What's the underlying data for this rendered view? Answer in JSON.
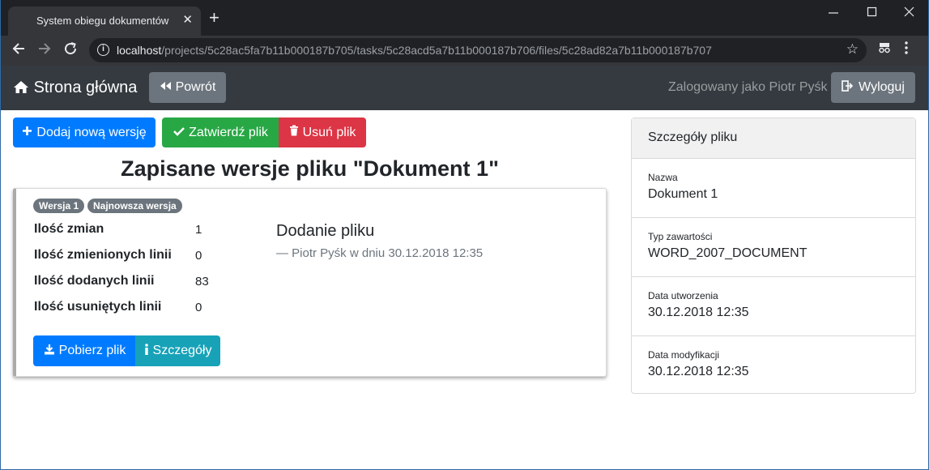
{
  "browser": {
    "tab_title": "System obiegu dokumentów",
    "tab_close": "✕",
    "new_tab": "+",
    "url_host": "localhost",
    "url_path": "/projects/5c28ac5fa7b11b000187b705/tasks/5c28acd5a7b11b000187b706/files/5c28ad82a7b11b000187b707",
    "icons": [
      "back-icon",
      "forward-icon",
      "reload-icon",
      "info-icon",
      "star-icon",
      "extension-icon",
      "menu-icon"
    ]
  },
  "navbar": {
    "brand": "Strona główna",
    "back_label": "Powrót",
    "logged_as": "Zalogowany jako Piotr Pyśk",
    "logout_label": "Wyloguj"
  },
  "toolbar": {
    "add_version": "Dodaj nową wersję",
    "approve": "Zatwierdź plik",
    "delete": "Usuń plik"
  },
  "page": {
    "title": "Zapisane wersje pliku \"Dokument 1\""
  },
  "version": {
    "badges": [
      "Wersja 1",
      "Najnowsza wersja"
    ],
    "stats": [
      {
        "label": "Ilość zmian",
        "value": "1"
      },
      {
        "label": "Ilość zmienionych linii",
        "value": "0"
      },
      {
        "label": "Ilość dodanych linii",
        "value": "83"
      },
      {
        "label": "Ilość usuniętych linii",
        "value": "0"
      }
    ],
    "commit_message": "Dodanie pliku",
    "commit_meta": "—  Piotr Pyśk w dniu 30.12.2018 12:35",
    "download_label": "Pobierz plik",
    "details_label": "Szczegóły"
  },
  "sidebar": {
    "header": "Szczegóły pliku",
    "items": [
      {
        "label": "Nazwa",
        "value": "Dokument 1"
      },
      {
        "label": "Typ zawartości",
        "value": "WORD_2007_DOCUMENT"
      },
      {
        "label": "Data utworzenia",
        "value": "30.12.2018 12:35"
      },
      {
        "label": "Data modyfikacji",
        "value": "30.12.2018 12:35"
      }
    ]
  },
  "colors": {
    "primary": "#007bff",
    "success": "#28a745",
    "danger": "#dc3545",
    "info": "#17a2b8",
    "secondary": "#6c757d",
    "navbar": "#343a40"
  }
}
